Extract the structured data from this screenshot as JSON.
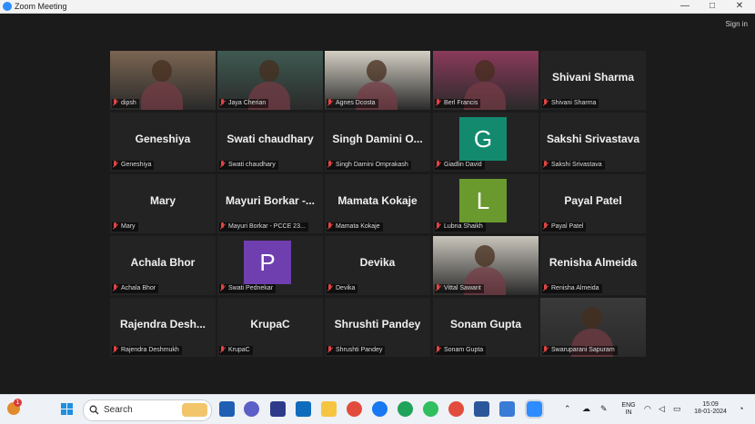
{
  "window": {
    "title": "Zoom Meeting",
    "minimize": "—",
    "maximize": "□",
    "close": "✕"
  },
  "toolbar": {
    "signin": "Sign in"
  },
  "participants": [
    {
      "id": "p1",
      "name": "dipsh",
      "label": "dipsh",
      "type": "video",
      "tone": "#7b6552"
    },
    {
      "id": "p2",
      "name": "Jaya Cherian",
      "label": "Jaya Cherian",
      "type": "video",
      "tone": "#3f5a52"
    },
    {
      "id": "p3",
      "name": "Agnes Dcosta",
      "label": "Agnes Dcosta",
      "type": "video",
      "tone": "#d4cfc4",
      "active": true
    },
    {
      "id": "p4",
      "name": "Berl Francis",
      "label": "Berl Francis",
      "type": "video",
      "tone": "#8a3a5a"
    },
    {
      "id": "p5",
      "name": "Shivani Sharma",
      "label": "Shivani Sharma",
      "type": "name"
    },
    {
      "id": "p6",
      "name": "Geneshiya",
      "label": "Geneshiya",
      "type": "name"
    },
    {
      "id": "p7",
      "name": "Swati chaudhary",
      "label": "Swati chaudhary",
      "type": "name"
    },
    {
      "id": "p8",
      "name": "Singh Damini O...",
      "label": "Singh Damini Omprakash",
      "type": "name"
    },
    {
      "id": "p9",
      "name": "G",
      "label": "Giadlin David",
      "type": "avatar",
      "color": "#138a6e"
    },
    {
      "id": "p10",
      "name": "Sakshi Srivastava",
      "label": "Sakshi Srivastava",
      "type": "name"
    },
    {
      "id": "p11",
      "name": "Mary",
      "label": "Mary",
      "type": "name"
    },
    {
      "id": "p12",
      "name": "Mayuri Borkar -...",
      "label": "Mayuri Borkar - PCCE 23...",
      "type": "name"
    },
    {
      "id": "p13",
      "name": "Mamata Kokaje",
      "label": "Mamata Kokaje",
      "type": "name"
    },
    {
      "id": "p14",
      "name": "L",
      "label": "Lubna Shaikh",
      "type": "avatar",
      "color": "#6a9a2e"
    },
    {
      "id": "p15",
      "name": "Payal Patel",
      "label": "Payal Patel",
      "type": "name"
    },
    {
      "id": "p16",
      "name": "Achala Bhor",
      "label": "Achala Bhor",
      "type": "name"
    },
    {
      "id": "p17",
      "name": "P",
      "label": "Swati Pednekar",
      "type": "avatar",
      "color": "#6f3fb0"
    },
    {
      "id": "p18",
      "name": "Devika",
      "label": "Devika",
      "type": "name"
    },
    {
      "id": "p19",
      "name": "Vittal Sawant",
      "label": "Vittal Sawant",
      "type": "video",
      "tone": "#c9c5bc"
    },
    {
      "id": "p20",
      "name": "Renisha Almeida",
      "label": "Renisha Almeida",
      "type": "name"
    },
    {
      "id": "p21",
      "name": "Rajendra Desh...",
      "label": "Rajendra Deshmukh",
      "type": "name"
    },
    {
      "id": "p22",
      "name": "KrupaC",
      "label": "KrupaC",
      "type": "name"
    },
    {
      "id": "p23",
      "name": "Shrushti Pandey",
      "label": "Shrushti Pandey",
      "type": "name"
    },
    {
      "id": "p24",
      "name": "Sonam Gupta",
      "label": "Sonam Gupta",
      "type": "name"
    },
    {
      "id": "p25",
      "name": "Swaruparani Sapuram",
      "label": "Swaruparani Sapuram",
      "type": "video",
      "tone": "#3a3a3a"
    }
  ],
  "taskbar": {
    "search_label": "Search",
    "weather_badge": "1",
    "language": "ENG",
    "language_region": "IN",
    "time": "15:09",
    "date": "18-01-2024"
  }
}
